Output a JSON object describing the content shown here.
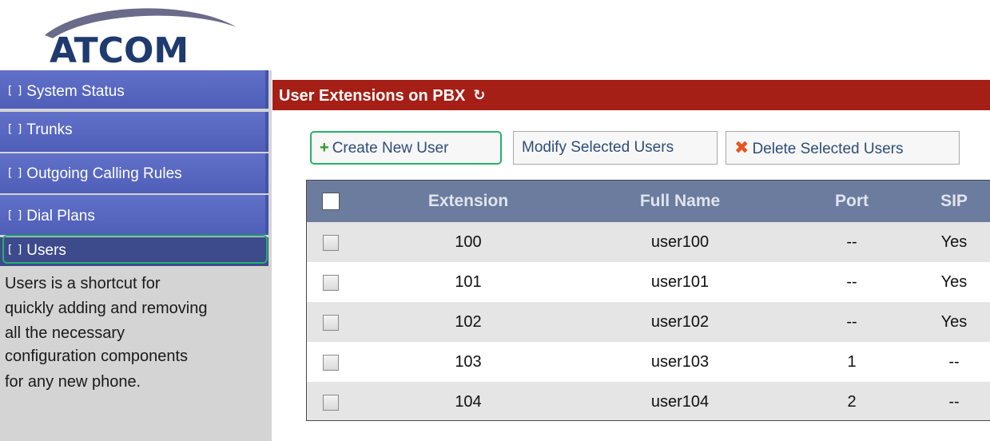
{
  "logo": {
    "text": "ATCOM"
  },
  "sidebar": {
    "items": [
      {
        "label": "System Status"
      },
      {
        "label": "Trunks"
      },
      {
        "label": "Outgoing Calling Rules"
      },
      {
        "label": "Dial Plans"
      },
      {
        "label": "Users"
      }
    ],
    "help_lines": [
      "Users is a shortcut for",
      "quickly adding and removing",
      "all the necessary",
      "configuration components",
      "for any new phone."
    ]
  },
  "header": {
    "title": "User Extensions on PBX"
  },
  "toolbar": {
    "create_label": "Create New User",
    "modify_label": "Modify Selected Users",
    "delete_label": "Delete Selected Users"
  },
  "table": {
    "columns": [
      "Extension",
      "Full Name",
      "Port",
      "SIP"
    ],
    "rows": [
      {
        "extension": "100",
        "name": "user100",
        "port": "--",
        "sip": "Yes"
      },
      {
        "extension": "101",
        "name": "user101",
        "port": "--",
        "sip": "Yes"
      },
      {
        "extension": "102",
        "name": "user102",
        "port": "--",
        "sip": "Yes"
      },
      {
        "extension": "103",
        "name": "user103",
        "port": "1",
        "sip": "--"
      },
      {
        "extension": "104",
        "name": "user104",
        "port": "2",
        "sip": "--"
      }
    ]
  },
  "colors": {
    "header_bar": "#a51f16",
    "nav_bg": "#5565bf",
    "nav_active": "#3d4a8c",
    "table_head": "#6b7c9e",
    "highlight": "#27b06a"
  },
  "icons": {
    "refresh": "refresh-icon",
    "create": "plus-icon",
    "delete": "x-icon",
    "nav_bullet": "bracket-icon"
  }
}
